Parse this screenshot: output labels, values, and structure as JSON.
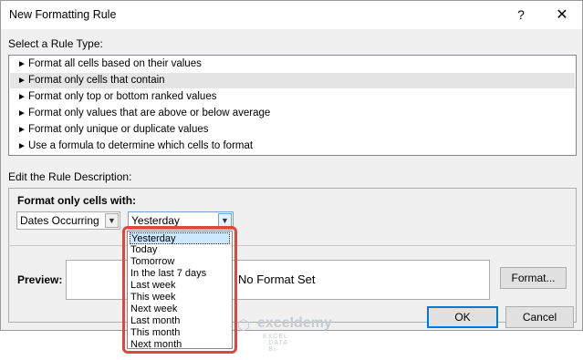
{
  "window": {
    "title": "New Formatting Rule",
    "help": "?",
    "close": "✕"
  },
  "rule_type": {
    "label": "Select a Rule Type:",
    "items": [
      "Format all cells based on their values",
      "Format only cells that contain",
      "Format only top or bottom ranked values",
      "Format only values that are above or below average",
      "Format only unique or duplicate values",
      "Use a formula to determine which cells to format"
    ],
    "selected_index": 1
  },
  "description": {
    "label": "Edit the Rule Description:",
    "format_label": "Format only cells with:",
    "condition_value": "Dates Occurring",
    "period_value": "Yesterday",
    "period_options": [
      "Yesterday",
      "Today",
      "Tomorrow",
      "In the last 7 days",
      "Last week",
      "This week",
      "Next week",
      "Last month",
      "This month",
      "Next month"
    ]
  },
  "preview": {
    "label": "Preview:",
    "text": "No Format Set",
    "format_button": "Format..."
  },
  "buttons": {
    "ok": "OK",
    "cancel": "Cancel"
  },
  "watermark": {
    "name": "exceldemy",
    "tagline": "EXCEL · DATA · BI"
  },
  "colors": {
    "highlight_outline": "#e0463a",
    "ok_border": "#0078d7",
    "selected_option": "#cce8ff"
  }
}
